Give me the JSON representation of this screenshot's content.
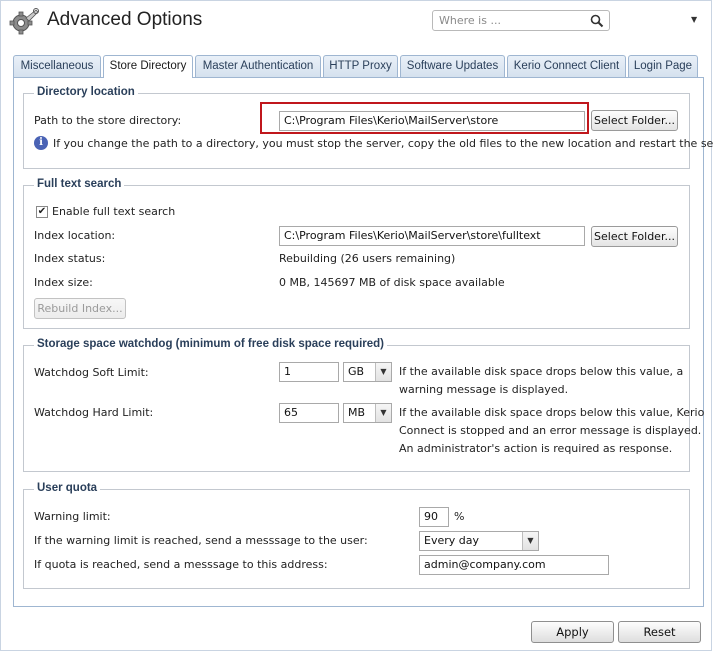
{
  "window": {
    "title": "Advanced Options"
  },
  "search": {
    "placeholder": "Where is ...",
    "value": ""
  },
  "tabs": [
    {
      "label": "Miscellaneous",
      "active": false
    },
    {
      "label": "Store Directory",
      "active": true
    },
    {
      "label": "Master Authentication",
      "active": false
    },
    {
      "label": "HTTP Proxy",
      "active": false
    },
    {
      "label": "Software Updates",
      "active": false
    },
    {
      "label": "Kerio Connect Client",
      "active": false
    },
    {
      "label": "Login Page",
      "active": false
    }
  ],
  "directory": {
    "legend": "Directory location",
    "path_label": "Path to the store directory:",
    "path_value": "C:\\Program Files\\Kerio\\MailServer\\store",
    "select_folder": "Select Folder...",
    "info_text": "If you change the path to a directory, you must stop the server, copy the old files to the new location and restart the server."
  },
  "fulltext": {
    "legend": "Full text search",
    "enable_label": "Enable full text search",
    "enabled": true,
    "index_location_label": "Index location:",
    "index_location_value": "C:\\Program Files\\Kerio\\MailServer\\store\\fulltext",
    "select_folder": "Select Folder...",
    "index_status_label": "Index status:",
    "index_status_value": "Rebuilding (26 users remaining)",
    "index_size_label": "Index size:",
    "index_size_value": "0 MB, 145697 MB of disk space available",
    "rebuild_button": "Rebuild Index..."
  },
  "watchdog": {
    "legend": "Storage space watchdog (minimum of free disk space required)",
    "soft_label": "Watchdog Soft Limit:",
    "soft_value": "1",
    "soft_unit": "GB",
    "soft_desc_1": "If the available disk space drops below this value, a",
    "soft_desc_2": "warning message is displayed.",
    "hard_label": "Watchdog Hard Limit:",
    "hard_value": "65",
    "hard_unit": "MB",
    "hard_desc_1": "If the available disk space drops below this value, Kerio",
    "hard_desc_2": "Connect is stopped and an error message is displayed.",
    "hard_desc_3": "An administrator's action is required as response."
  },
  "quota": {
    "legend": "User quota",
    "warning_label": "Warning limit:",
    "warning_value": "90",
    "warning_unit": "%",
    "send_user_label": "If the warning limit is reached, send a messsage to the user:",
    "send_user_value": "Every day",
    "send_address_label": "If quota is reached, send a messsage to this address:",
    "send_address_value": "admin@company.com"
  },
  "footer": {
    "apply": "Apply",
    "reset": "Reset"
  },
  "icons": {
    "app": "gear-wrench-icon",
    "search": "search-icon",
    "menu": "chevron-down-icon",
    "info": "info-icon",
    "check": "checkmark-icon"
  },
  "colors": {
    "accent_border": "#9fb6d1",
    "highlight": "#c0171c",
    "info": "#4a63b5"
  }
}
